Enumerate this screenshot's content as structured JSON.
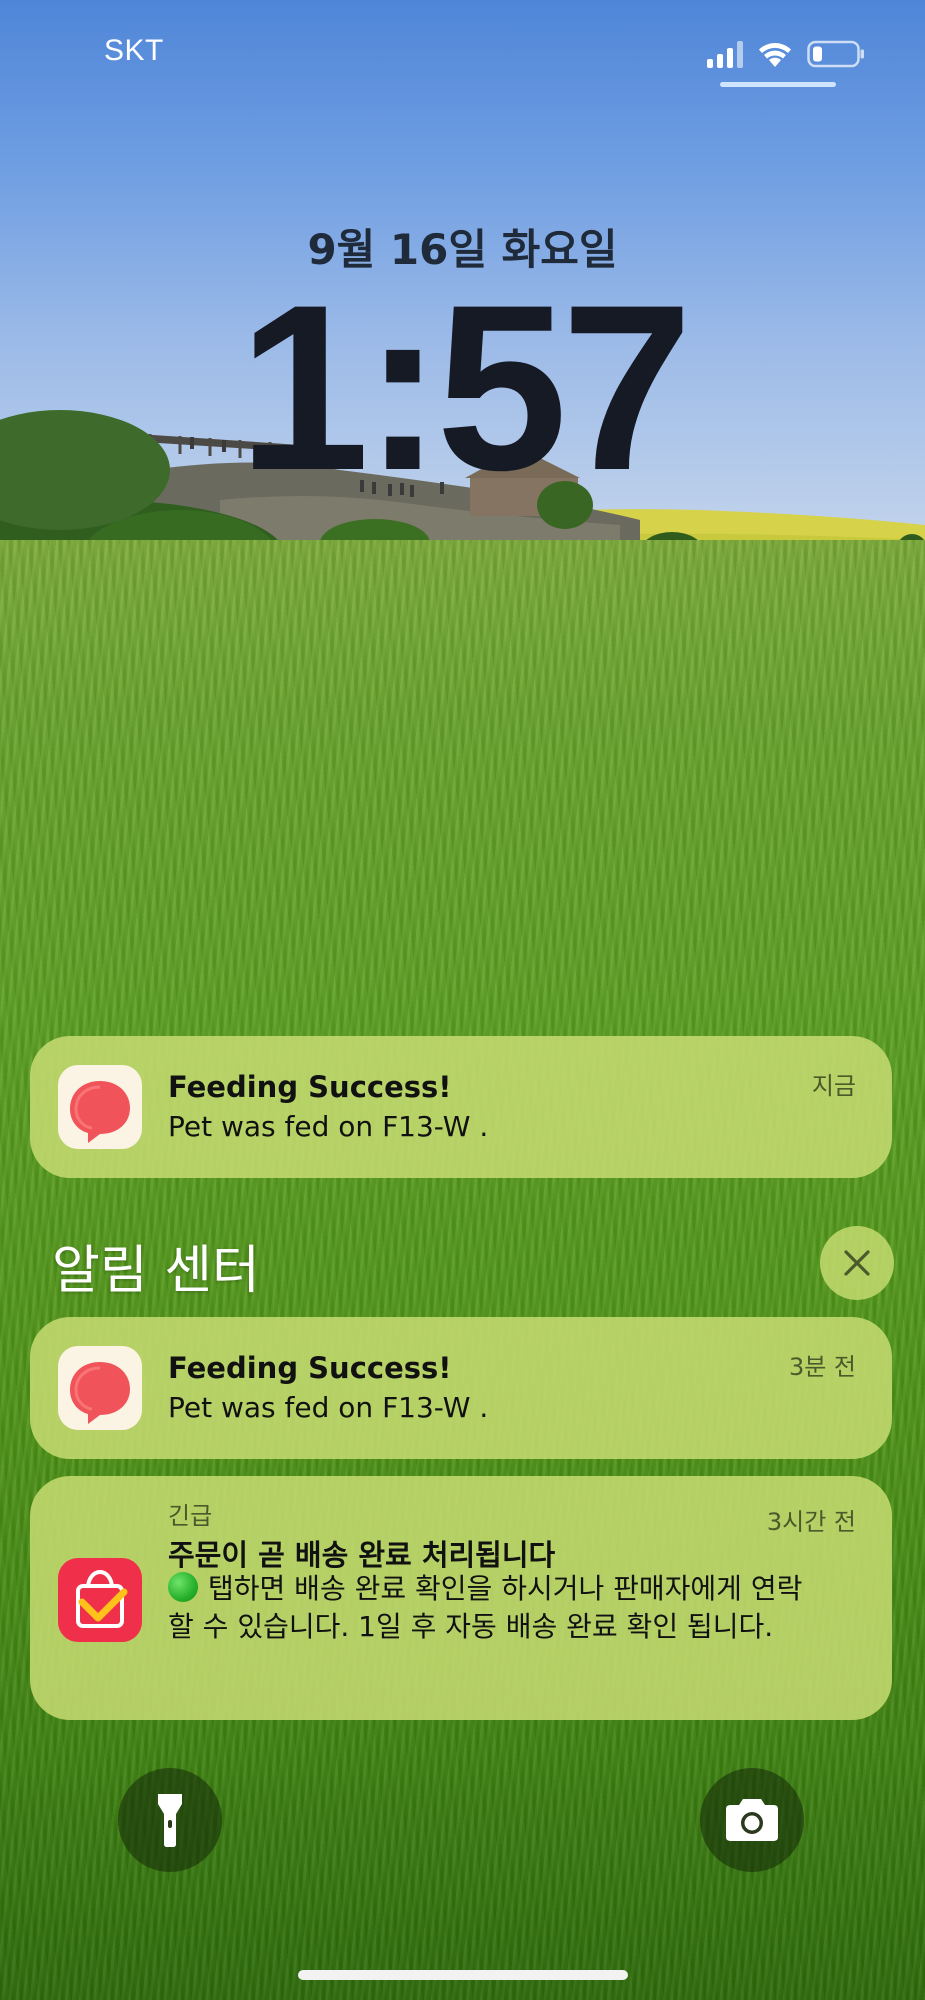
{
  "status_bar": {
    "carrier": "SKT",
    "icons": [
      "signal-icon",
      "wifi-icon",
      "battery-icon"
    ],
    "battery_level": 0.2
  },
  "lock_screen": {
    "date": "9월 16일 화요일",
    "time": "1:57"
  },
  "banner_notification": {
    "app_icon": "pet-feeder-app-icon",
    "title": "Feeding Success!",
    "body": "Pet was fed on F13-W .",
    "time": "지금"
  },
  "notification_center": {
    "heading": "알림 센터",
    "clear_icon": "close-icon",
    "notifications": [
      {
        "app_icon": "pet-feeder-app-icon",
        "title": "Feeding Success!",
        "body": "Pet was fed on F13-W .",
        "time": "3분 전"
      },
      {
        "app_icon": "shopping-bag-app-icon",
        "tag": "긴급",
        "title": "주문이 곧 배송 완료 처리됩니다",
        "body": "탭하면 배송 완료 확인을 하시거나 판매자에게 연락할 수 있습니다. 1일 후 자동 배송 완료 확인 됩니다.",
        "time": "3시간 전"
      }
    ]
  },
  "quick_actions": {
    "left": "flashlight-icon",
    "right": "camera-icon"
  },
  "colors": {
    "notification_bg": "#c4da70",
    "clock_text": "#151a24",
    "pet_icon_red": "#f0535a",
    "shop_icon_red": "#f0304a"
  }
}
